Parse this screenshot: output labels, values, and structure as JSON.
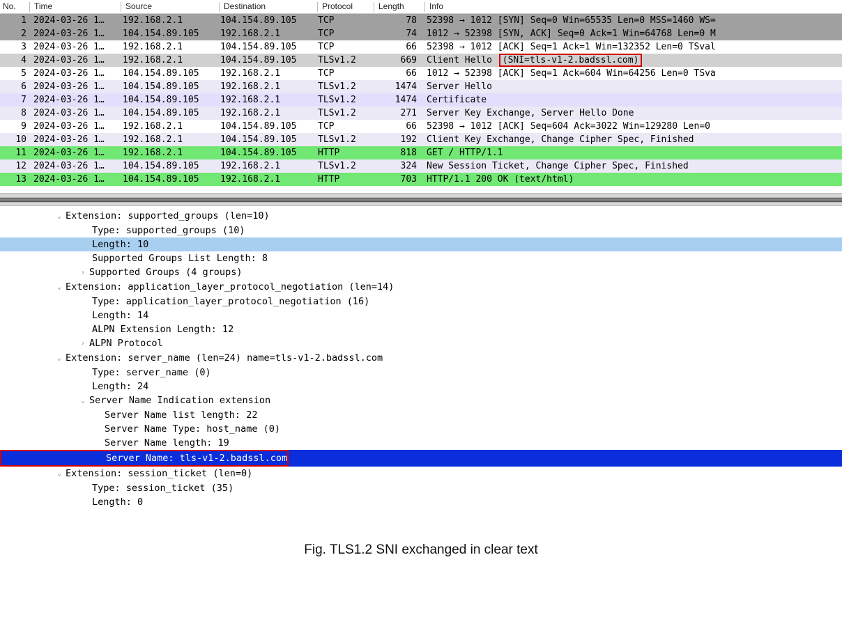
{
  "columns": {
    "no": "No.",
    "time": "Time",
    "source": "Source",
    "destination": "Destination",
    "protocol": "Protocol",
    "length": "Length",
    "info": "Info"
  },
  "packets": [
    {
      "no": "1",
      "time": "2024-03-26 1…",
      "src": "192.168.2.1",
      "dst": "104.154.89.105",
      "proto": "TCP",
      "len": "78",
      "info": "52398 → 1012 [SYN] Seq=0 Win=65535 Len=0 MSS=1460 WS=",
      "cls": "sel"
    },
    {
      "no": "2",
      "time": "2024-03-26 1…",
      "src": "104.154.89.105",
      "dst": "192.168.2.1",
      "proto": "TCP",
      "len": "74",
      "info": "1012 → 52398 [SYN, ACK] Seq=0 Ack=1 Win=64768 Len=0 M",
      "cls": "sel"
    },
    {
      "no": "3",
      "time": "2024-03-26 1…",
      "src": "192.168.2.1",
      "dst": "104.154.89.105",
      "proto": "TCP",
      "len": "66",
      "info": "52398 → 1012 [ACK] Seq=1 Ack=1 Win=132352 Len=0 TSval",
      "cls": "white"
    },
    {
      "no": "4",
      "time": "2024-03-26 1…",
      "src": "192.168.2.1",
      "dst": "104.154.89.105",
      "proto": "TLSv1.2",
      "len": "669",
      "info": "Client Hello",
      "info_boxed": "(SNI=tls-v1-2.badssl.com)",
      "cls": "sel2"
    },
    {
      "no": "5",
      "time": "2024-03-26 1…",
      "src": "104.154.89.105",
      "dst": "192.168.2.1",
      "proto": "TCP",
      "len": "66",
      "info": "1012 → 52398 [ACK] Seq=1 Ack=604 Win=64256 Len=0 TSva",
      "cls": "white"
    },
    {
      "no": "6",
      "time": "2024-03-26 1…",
      "src": "104.154.89.105",
      "dst": "192.168.2.1",
      "proto": "TLSv1.2",
      "len": "1474",
      "info": "Server Hello",
      "cls": "tlsA"
    },
    {
      "no": "7",
      "time": "2024-03-26 1…",
      "src": "104.154.89.105",
      "dst": "192.168.2.1",
      "proto": "TLSv1.2",
      "len": "1474",
      "info": "Certificate",
      "cls": "tlsB"
    },
    {
      "no": "8",
      "time": "2024-03-26 1…",
      "src": "104.154.89.105",
      "dst": "192.168.2.1",
      "proto": "TLSv1.2",
      "len": "271",
      "info": "Server Key Exchange, Server Hello Done",
      "cls": "tlsA"
    },
    {
      "no": "9",
      "time": "2024-03-26 1…",
      "src": "192.168.2.1",
      "dst": "104.154.89.105",
      "proto": "TCP",
      "len": "66",
      "info": "52398 → 1012 [ACK] Seq=604 Ack=3022 Win=129280 Len=0",
      "cls": "white"
    },
    {
      "no": "10",
      "time": "2024-03-26 1…",
      "src": "192.168.2.1",
      "dst": "104.154.89.105",
      "proto": "TLSv1.2",
      "len": "192",
      "info": "Client Key Exchange, Change Cipher Spec, Finished",
      "cls": "tlsA"
    },
    {
      "no": "11",
      "time": "2024-03-26 1…",
      "src": "192.168.2.1",
      "dst": "104.154.89.105",
      "proto": "HTTP",
      "len": "818",
      "info": "GET / HTTP/1.1",
      "cls": "http"
    },
    {
      "no": "12",
      "time": "2024-03-26 1…",
      "src": "104.154.89.105",
      "dst": "192.168.2.1",
      "proto": "TLSv1.2",
      "len": "324",
      "info": "New Session Ticket, Change Cipher Spec, Finished",
      "cls": "tlsA"
    },
    {
      "no": "13",
      "time": "2024-03-26 1…",
      "src": "104.154.89.105",
      "dst": "192.168.2.1",
      "proto": "HTTP",
      "len": "703",
      "info": "HTTP/1.1 200 OK  (text/html)",
      "cls": "http"
    }
  ],
  "tree": {
    "l1": "Extension: supported_groups (len=10)",
    "l2": "Type: supported_groups (10)",
    "l3": "Length: 10",
    "l4": "Supported Groups List Length: 8",
    "l5": "Supported Groups (4 groups)",
    "l6": "Extension: application_layer_protocol_negotiation (len=14)",
    "l7": "Type: application_layer_protocol_negotiation (16)",
    "l8": "Length: 14",
    "l9": "ALPN Extension Length: 12",
    "l10": "ALPN Protocol",
    "l11": "Extension: server_name (len=24) name=tls-v1-2.badssl.com",
    "l12": "Type: server_name (0)",
    "l13": "Length: 24",
    "l14": "Server Name Indication extension",
    "l15": "Server Name list length: 22",
    "l16": "Server Name Type: host_name (0)",
    "l17": "Server Name length: 19",
    "l18": "Server Name: tls-v1-2.badssl.com",
    "l19": "Extension: session_ticket (len=0)",
    "l20": "Type: session_ticket (35)",
    "l21": "Length: 0"
  },
  "caption": "Fig. TLS1.2  SNI exchanged in clear text"
}
